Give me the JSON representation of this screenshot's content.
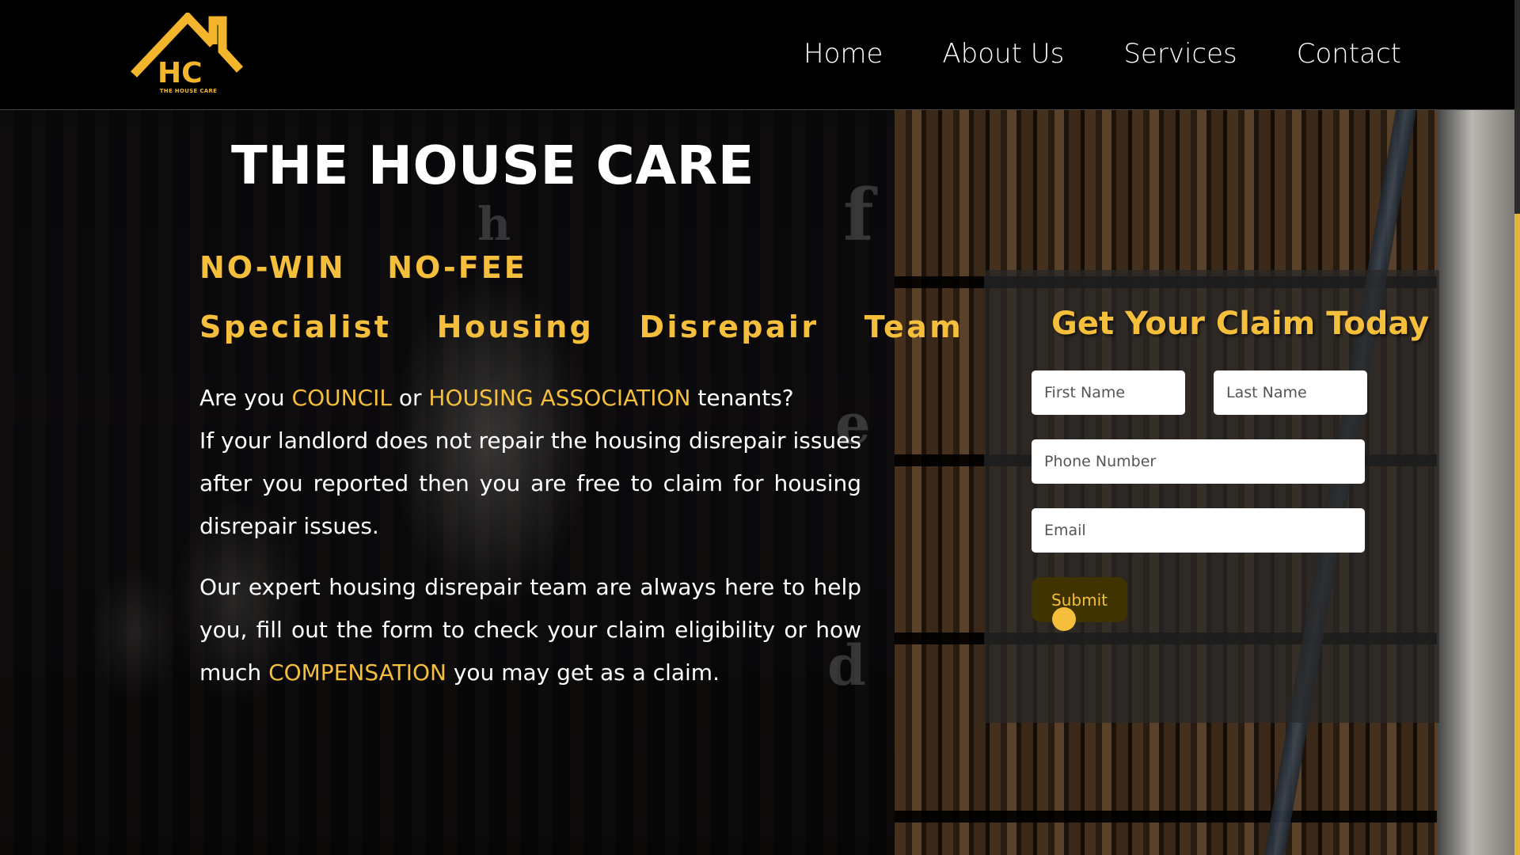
{
  "brand": {
    "name": "THE HOUSE CARE",
    "monogram": "HC",
    "color": "#f5bf3c"
  },
  "nav": {
    "items": [
      {
        "label": "Home"
      },
      {
        "label": "About Us"
      },
      {
        "label": "Services"
      },
      {
        "label": "Contact"
      }
    ]
  },
  "hero": {
    "title": "THE HOUSE CARE",
    "tagline1": "NO-WIN  NO-FEE",
    "tagline2": "Specialist  Housing  Disrepair  Team",
    "p1": {
      "a": "Are you ",
      "council": "COUNCIL",
      "b": " or ",
      "housing_association": "HOUSING ASSOCIATION",
      "c": " tenants?",
      "d": "If your landlord does not repair the housing disrepair issues after you reported then you are free to claim for housing disrepair issues."
    },
    "p2": {
      "a": "Our expert housing disrepair team are always here to help you, fill out the form to check your claim eligibility or how much ",
      "compensation": "COMPENSATION",
      "b": " you may get as a claim."
    }
  },
  "form": {
    "title": "Get Your Claim Today",
    "first_name_placeholder": "First Name",
    "last_name_placeholder": "Last Name",
    "phone_placeholder": "Phone Number",
    "email_placeholder": "Email",
    "submit_label": "Submit"
  }
}
